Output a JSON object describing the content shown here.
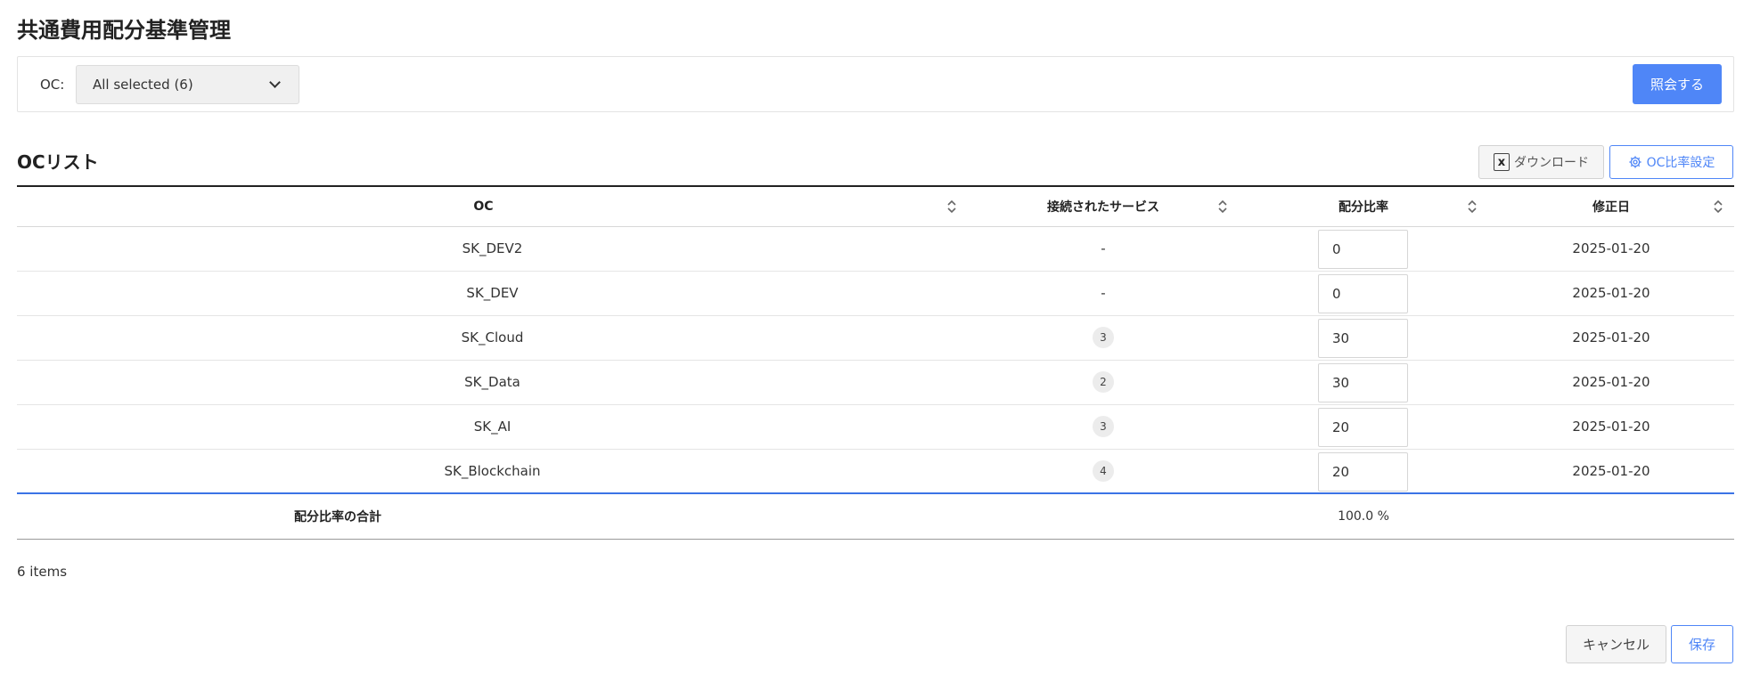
{
  "page": {
    "title": "共通費用配分基準管理"
  },
  "filter": {
    "oc_label": "OC:",
    "oc_select_value": "All selected (6)",
    "search_label": "照会する"
  },
  "section": {
    "title": "OCリスト",
    "download_label": "ダウンロード",
    "download_icon": "excel-icon",
    "ratio_settings_label": "OC比率設定",
    "ratio_settings_icon": "gear-icon"
  },
  "table": {
    "columns": [
      "OC",
      "接続されたサービス",
      "配分比率",
      "修正日"
    ],
    "rows": [
      {
        "oc": "SK_DEV2",
        "services": "-",
        "ratio": "0",
        "modified": "2025-01-20"
      },
      {
        "oc": "SK_DEV",
        "services": "-",
        "ratio": "0",
        "modified": "2025-01-20"
      },
      {
        "oc": "SK_Cloud",
        "services": "3",
        "ratio": "30",
        "modified": "2025-01-20"
      },
      {
        "oc": "SK_Data",
        "services": "2",
        "ratio": "30",
        "modified": "2025-01-20"
      },
      {
        "oc": "SK_AI",
        "services": "3",
        "ratio": "20",
        "modified": "2025-01-20"
      },
      {
        "oc": "SK_Blockchain",
        "services": "4",
        "ratio": "20",
        "modified": "2025-01-20"
      }
    ],
    "total_label": "配分比率の合計",
    "total_value": "100.0 %"
  },
  "footer": {
    "items_count": "6 items",
    "cancel_label": "キャンセル",
    "save_label": "保存"
  },
  "colors": {
    "primary": "#4f86f7",
    "total_rule": "#3b73e6"
  }
}
